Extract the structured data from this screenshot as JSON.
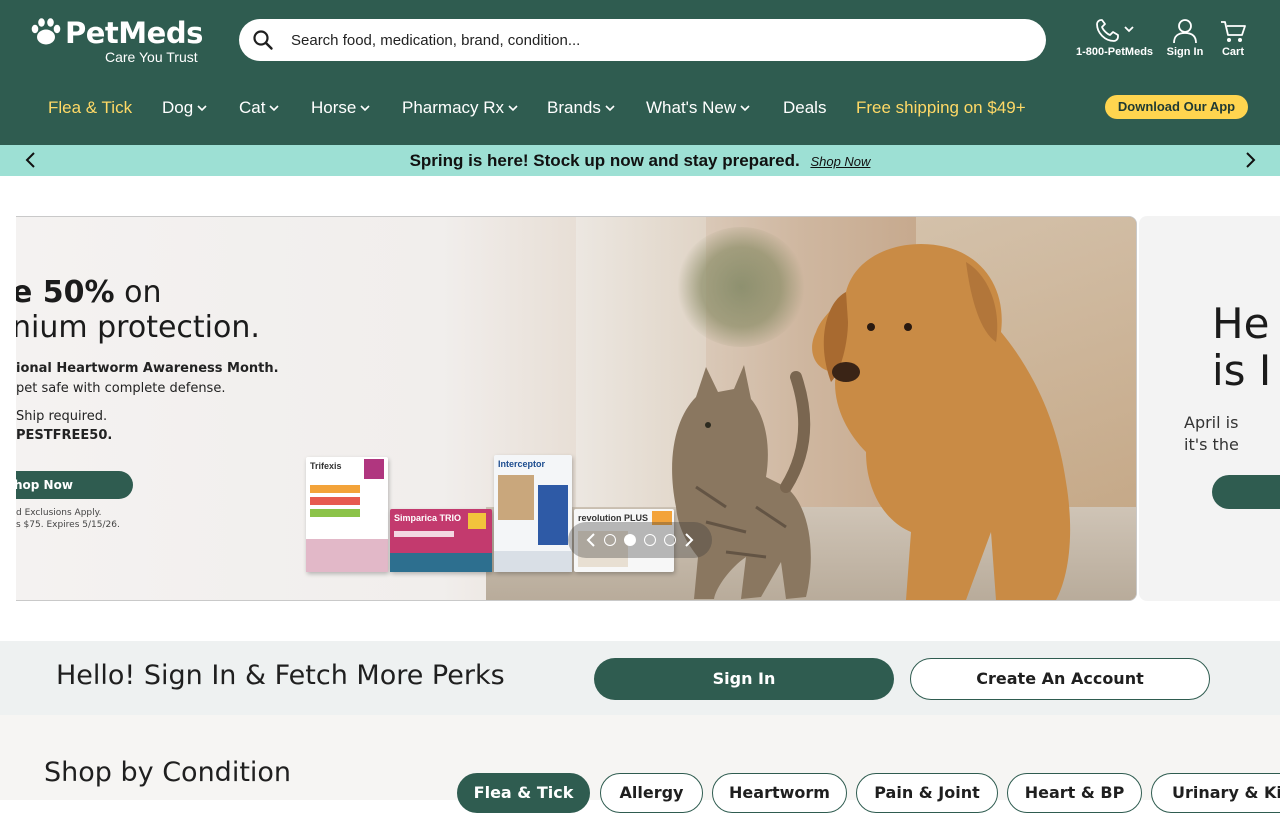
{
  "brand": {
    "name": "PetMeds",
    "tagline": "Care You Trust"
  },
  "search": {
    "placeholder": "Search food, medication, brand, condition..."
  },
  "utility": {
    "phone_label": "1-800-PetMeds",
    "signin_label": "Sign In",
    "cart_label": "Cart"
  },
  "nav": {
    "items": [
      {
        "label": "Flea & Tick",
        "dropdown": false,
        "highlight": true
      },
      {
        "label": "Dog",
        "dropdown": true
      },
      {
        "label": "Cat",
        "dropdown": true
      },
      {
        "label": "Horse",
        "dropdown": true
      },
      {
        "label": "Pharmacy Rx",
        "dropdown": true
      },
      {
        "label": "Brands",
        "dropdown": true
      },
      {
        "label": "What's New",
        "dropdown": true
      },
      {
        "label": "Deals",
        "dropdown": false
      }
    ],
    "free_shipping": "Free shipping on $49+",
    "app_button": "Download Our App"
  },
  "promo": {
    "message": "Spring is here! Stock up now and stay prepared.",
    "link": "Shop Now"
  },
  "hero": {
    "headline_bold": "e 50%",
    "headline_rest": " on",
    "headline_line2": "nium protection.",
    "sub1": "ional Heartworm Awareness Month.",
    "sub2": "pet safe with complete defense.",
    "sub3": "Ship required.",
    "sub4": "PESTFREE50.",
    "button": "hop Now",
    "fine1": "d Exclusions Apply.",
    "fine2": "s $75. Expires 5/15/26.",
    "products": [
      "Trifexis",
      "Simparica TRIO",
      "Interceptor",
      "revolution PLUS"
    ],
    "carousel": {
      "slides": 4,
      "active": 1
    }
  },
  "hero_next": {
    "line1": "He",
    "line2": "is I",
    "p1": "April is",
    "p2": "it's the"
  },
  "signin_band": {
    "title": "Hello! Sign In & Fetch More Perks",
    "signin_button": "Sign In",
    "create_button": "Create An Account"
  },
  "shop_by_condition": {
    "title": "Shop by Condition",
    "pills": [
      "Flea & Tick",
      "Allergy",
      "Heartworm",
      "Pain & Joint",
      "Heart & BP",
      "Urinary & Kid"
    ],
    "active": "Flea & Tick"
  },
  "colors": {
    "header_green": "#2f5c50",
    "promo_mint": "#9de0d4",
    "accent_yellow": "#ffd54f",
    "nav_highlight": "#ffd966"
  }
}
